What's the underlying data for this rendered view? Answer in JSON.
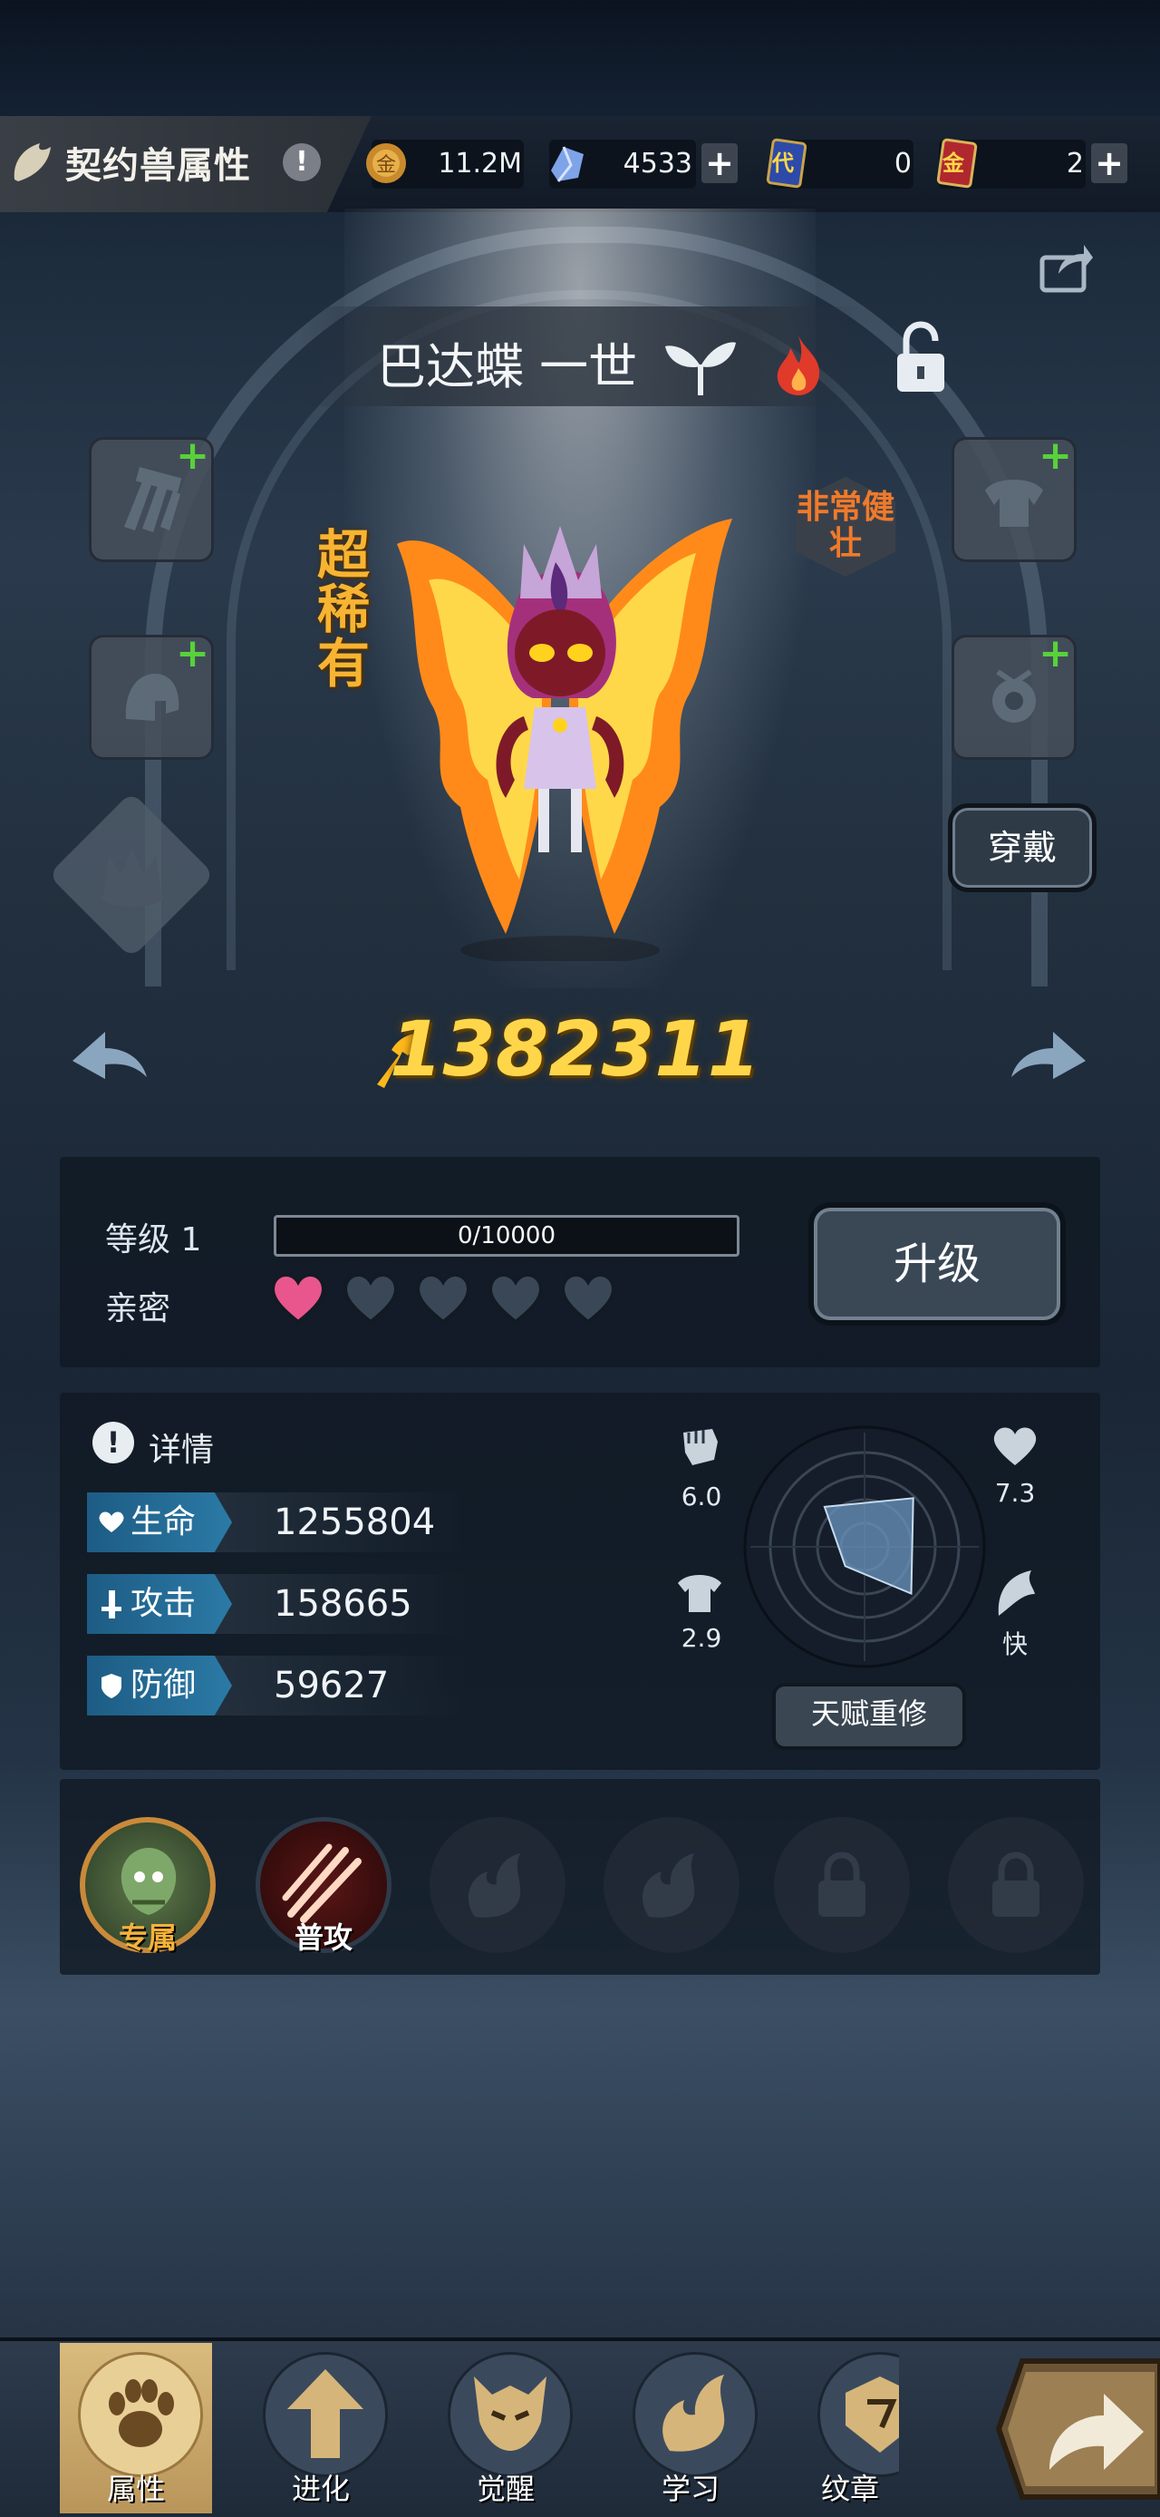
{
  "header": {
    "title": "契约兽属性",
    "resources": [
      {
        "icon": "gold-coin-icon",
        "value": "11.2M"
      },
      {
        "icon": "blue-crystal-icon",
        "value": "4533"
      },
      {
        "icon": "dai-card-icon",
        "value": "0",
        "card_text": "代"
      },
      {
        "icon": "jin-card-icon",
        "value": "2",
        "card_text": "金"
      }
    ]
  },
  "pet": {
    "name": "巴达蝶 一世",
    "rarity": "超稀有",
    "body_tag": "非常健壮",
    "wear_label": "穿戴",
    "power": "1382311"
  },
  "level": {
    "label": "等级 1",
    "xp_text": "0/10000",
    "xp_fraction": 0,
    "intimacy_label": "亲密",
    "hearts_filled": 1,
    "hearts_total": 5,
    "upgrade_label": "升级"
  },
  "details": {
    "title": "详情",
    "stats": [
      {
        "label": "生命",
        "value": "1255804"
      },
      {
        "label": "攻击",
        "value": "158665"
      },
      {
        "label": "防御",
        "value": "59627"
      }
    ],
    "radar": {
      "attack": "6.0",
      "hp": "7.3",
      "defense": "2.9",
      "speed": "快"
    },
    "reroll_label": "天赋重修"
  },
  "skills": [
    {
      "label": "专属",
      "state": "portrait"
    },
    {
      "label": "普攻",
      "state": "active"
    },
    {
      "label": "",
      "state": "empty"
    },
    {
      "label": "",
      "state": "empty"
    },
    {
      "label": "",
      "state": "locked"
    },
    {
      "label": "",
      "state": "locked"
    }
  ],
  "nav": [
    {
      "label": "属性",
      "icon": "paw-icon",
      "active": true
    },
    {
      "label": "进化",
      "icon": "up-arrow-icon",
      "active": false
    },
    {
      "label": "觉醒",
      "icon": "mask-icon",
      "active": false
    },
    {
      "label": "学习",
      "icon": "flame-icon",
      "active": false
    },
    {
      "label": "纹章",
      "icon": "crest-icon",
      "active": false
    }
  ],
  "colors": {
    "accent": "#ffd64a",
    "rarity": "#f7b433",
    "stat_label": "#2b7aa6",
    "plus_green": "#58d13a",
    "heart_pink": "#e8568d"
  }
}
